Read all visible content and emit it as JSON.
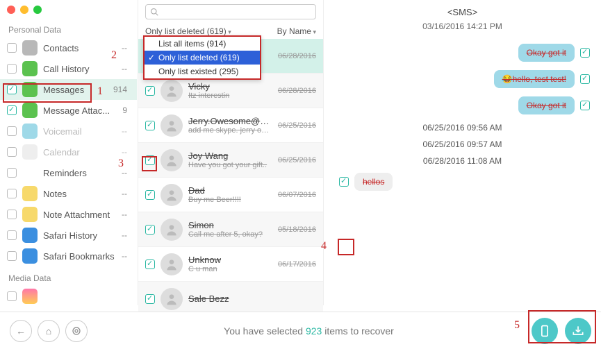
{
  "sidebar": {
    "header1": "Personal Data",
    "header2": "Media Data",
    "items": [
      {
        "label": "Contacts",
        "count": "--",
        "checked": false,
        "icon": "#b8b8b8"
      },
      {
        "label": "Call History",
        "count": "--",
        "checked": false,
        "icon": "#5bc24f"
      },
      {
        "label": "Messages",
        "count": "914",
        "checked": true,
        "icon": "#5bc24f",
        "selected": true
      },
      {
        "label": "Message Attac...",
        "count": "9",
        "checked": true,
        "icon": "#5bc24f"
      },
      {
        "label": "Voicemail",
        "count": "--",
        "checked": false,
        "icon": "#9fd9e8",
        "dim": true
      },
      {
        "label": "Calendar",
        "count": "--",
        "checked": false,
        "icon": "#eee",
        "dim": true
      },
      {
        "label": "Reminders",
        "count": "--",
        "checked": false,
        "icon": "#fff"
      },
      {
        "label": "Notes",
        "count": "--",
        "checked": false,
        "icon": "#f7d96b"
      },
      {
        "label": "Note Attachment",
        "count": "--",
        "checked": false,
        "icon": "#f7d96b"
      },
      {
        "label": "Safari History",
        "count": "--",
        "checked": false,
        "icon": "#3b8fe0"
      },
      {
        "label": "Safari Bookmarks",
        "count": "--",
        "checked": false,
        "icon": "#3b8fe0"
      }
    ]
  },
  "search": {
    "placeholder": ""
  },
  "filter": {
    "main": "Only list deleted (619)",
    "sort": "By Name"
  },
  "dropdown": {
    "items": [
      {
        "label": "List all items (914)"
      },
      {
        "label": "Only list deleted (619)",
        "selected": true
      },
      {
        "label": "Only list existed (295)"
      }
    ]
  },
  "threads": [
    {
      "name": "",
      "preview": "",
      "date": "06/28/2016",
      "selected": true
    },
    {
      "name": "Vicky",
      "preview": "Itz interestin",
      "date": "06/28/2016"
    },
    {
      "name": "Jerry.Owesome@aol.com",
      "preview": "add me skype. jerry ow...",
      "date": "06/25/2016"
    },
    {
      "name": "Joy Wang",
      "preview": "Have you got your gift..",
      "date": "06/25/2016"
    },
    {
      "name": "Dad",
      "preview": "Buy me Beer!!!!",
      "date": "06/07/2016"
    },
    {
      "name": "Simon",
      "preview": "Call me after 5, okay?",
      "date": "05/18/2016"
    },
    {
      "name": "Unknow",
      "preview": "C u man",
      "date": "06/17/2016"
    },
    {
      "name": "Sale Bezz",
      "preview": "",
      "date": ""
    }
  ],
  "detail": {
    "title": "<SMS>",
    "headerDate": "03/16/2016 14:21 PM",
    "messages": [
      {
        "text": "Okay got it",
        "out": true
      },
      {
        "text": "😂hello, test test!",
        "out": true
      },
      {
        "text": "Okay got it",
        "out": true
      }
    ],
    "timestamps": [
      "06/25/2016 09:56 AM",
      "06/25/2016 09:57 AM",
      "06/28/2016 11:08 AM"
    ],
    "incoming": {
      "text": "hellos"
    }
  },
  "footer": {
    "status_pre": "You have selected ",
    "status_count": "923",
    "status_post": " items to recover"
  },
  "annotations": {
    "n1": "1",
    "n2": "2",
    "n3": "3",
    "n4": "4",
    "n5": "5"
  }
}
